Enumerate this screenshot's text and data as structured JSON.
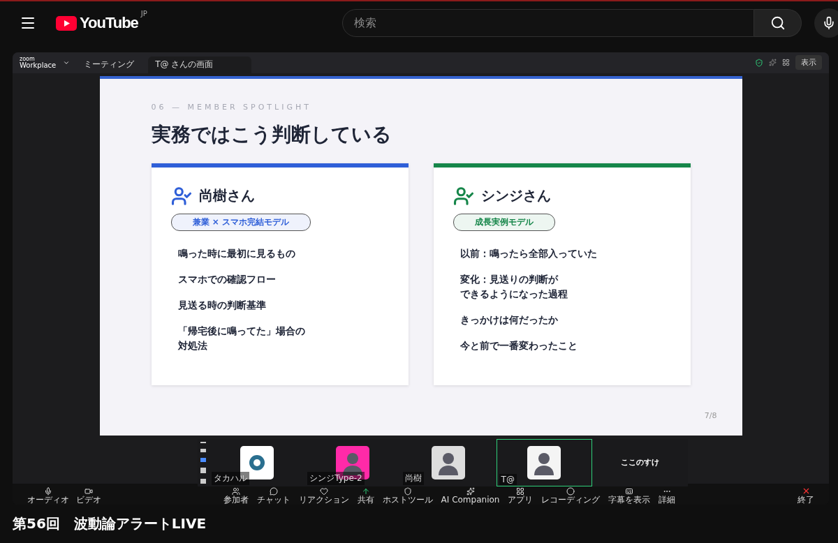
{
  "header": {
    "logo": "YouTube",
    "region": "JP",
    "search": {
      "placeholder": "検索"
    }
  },
  "zoom": {
    "brand_top": "zoom",
    "brand": "Workplace",
    "tabs": [
      {
        "label": "ミーティング",
        "selected": false
      },
      {
        "label": "T@ さんの画面",
        "selected": true
      }
    ],
    "view_button": "表示"
  },
  "slide": {
    "eyebrow": "06 — MEMBER SPOTLIGHT",
    "title": "実務ではこう判断している",
    "page": "7/8",
    "cards": [
      {
        "name": "尚樹さん",
        "tag": "兼業 × スマホ完結モデル",
        "color": "#2f5fd8",
        "items": [
          "鳴った時に最初に見るもの",
          "スマホでの確認フロー",
          "見送る時の判断基準",
          {
            "lines": [
              "「帰宅後に鳴ってた」場合の",
              "対処法"
            ]
          }
        ]
      },
      {
        "name": "シンジさん",
        "tag": "成長実例モデル",
        "color": "#16864a",
        "items": [
          "以前：鳴ったら全部入っていた",
          {
            "lines": [
              "変化：見送りの判断が",
              "できるようになった過程"
            ]
          },
          "きっかけは何だったか",
          "今と前で一番変わったこと"
        ]
      }
    ]
  },
  "participants": [
    {
      "name": "タカハル",
      "kind": "logo",
      "selected": false
    },
    {
      "name": "シンジType-2",
      "kind": "avatar",
      "selected": false
    },
    {
      "name": "尚樹",
      "kind": "avatar",
      "selected": false
    },
    {
      "name": "T@",
      "kind": "avatar",
      "selected": true
    },
    {
      "name": "ここのすけ",
      "kind": "text",
      "selected": false
    }
  ],
  "toolbar": {
    "left": [
      "オーディオ",
      "ビデオ"
    ],
    "center": [
      "参加者",
      "チャット",
      "リアクション",
      "共有",
      "ホストツール",
      "AI Companion",
      "アプリ",
      "レコーディング",
      "字幕を表示",
      "詳細"
    ],
    "end": "終了"
  },
  "video_title": "第56回　波動論アラートLIVE"
}
